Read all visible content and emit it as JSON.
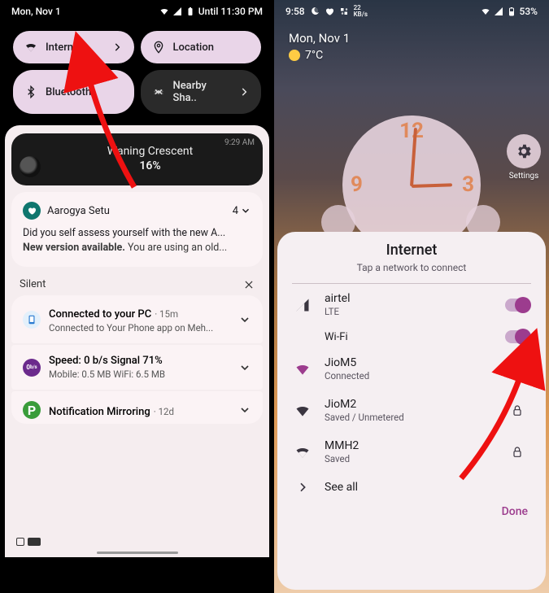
{
  "left": {
    "status": {
      "date": "Mon, Nov 1",
      "alarm": "Until 11:30 PM"
    },
    "qs": [
      {
        "label": "Internet",
        "chevron": true,
        "active": true
      },
      {
        "label": "Location",
        "chevron": false,
        "active": true
      },
      {
        "label": "Bluetooth",
        "chevron": false,
        "active": true
      },
      {
        "label": "Nearby Sha..",
        "chevron": true,
        "active": false
      }
    ],
    "moon": {
      "time": "9:29 AM",
      "title": "Waning Crescent",
      "pct": "16%"
    },
    "aarogya": {
      "app": "Aarogya Setu",
      "count": "4",
      "line1": "Did you self assess yourself with the new A...",
      "line2_a": "New version available. ",
      "line2_b": "You are using an old..."
    },
    "silent_label": "Silent",
    "pc": {
      "title": "Connected to your PC",
      "age": "15m",
      "sub": "Connected to Your Phone app on Meh..."
    },
    "speed": {
      "title": "Speed: 0 b/s   Signal 71%",
      "sub": "Mobile: 0.5 MB   WiFi: 6.5 MB"
    },
    "mirror": {
      "title": "Notification Mirroring",
      "age": "12d"
    }
  },
  "right": {
    "status": {
      "time": "9:58",
      "kbs": "22",
      "kbs_unit": "KB/s",
      "battery": "53%"
    },
    "date": "Mon, Nov 1",
    "temp": "7°C",
    "settings_label": "Settings",
    "sheet": {
      "title": "Internet",
      "subtitle": "Tap a network to connect",
      "mobile": {
        "name": "airtel",
        "tech": "LTE"
      },
      "wifi_label": "Wi-Fi",
      "networks": [
        {
          "name": "JioM5",
          "sub": "Connected",
          "action": "gear"
        },
        {
          "name": "JioM2",
          "sub": "Saved / Unmetered",
          "action": "lock"
        },
        {
          "name": "MMH2",
          "sub": "Saved",
          "action": "lock"
        }
      ],
      "see_all": "See all",
      "done": "Done"
    }
  }
}
